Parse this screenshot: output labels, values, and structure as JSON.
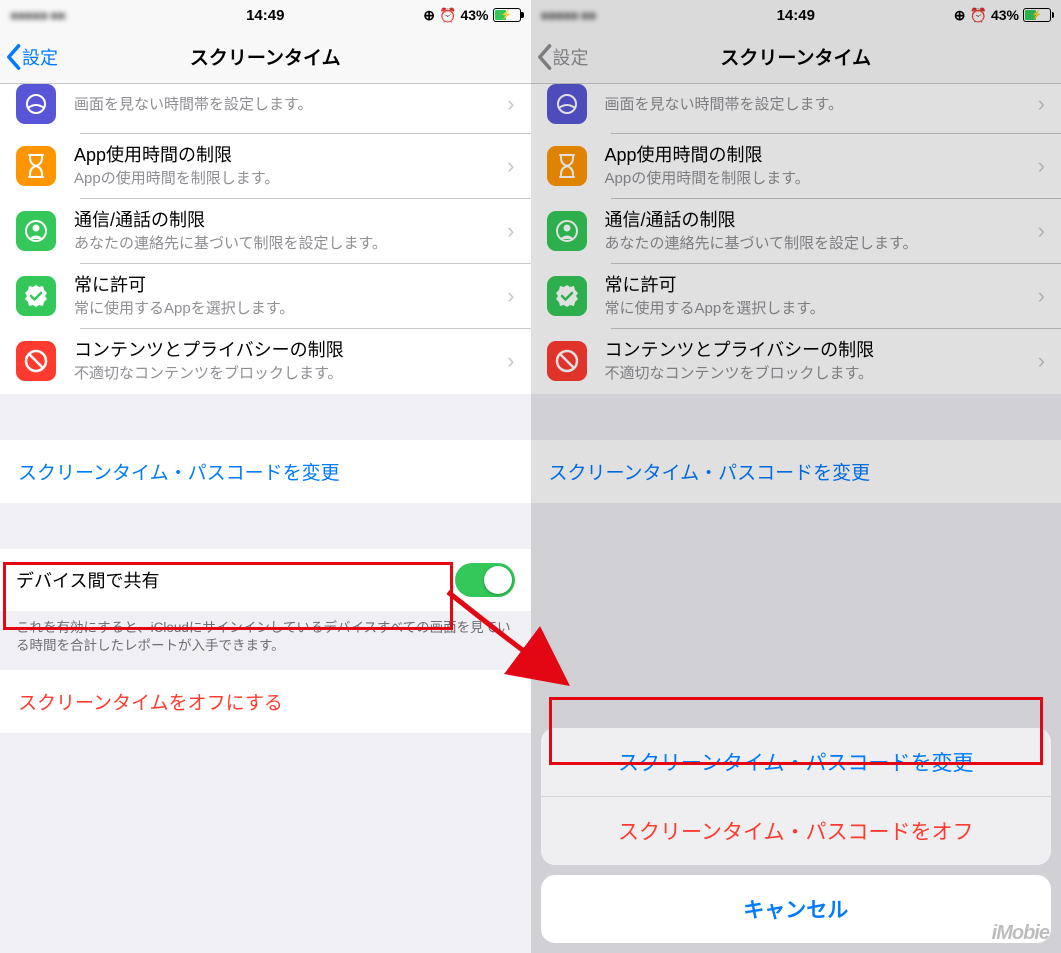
{
  "status": {
    "time": "14:49",
    "battery_pct": "43%",
    "lock_icon": "lock-rotation",
    "alarm_icon": "alarm"
  },
  "nav": {
    "back_label": "設定",
    "title": "スクリーンタイム"
  },
  "rows": {
    "downtime_sub": "画面を見ない時間帯を設定します。",
    "applimit_title": "App使用時間の制限",
    "applimit_sub": "Appの使用時間を制限します。",
    "comm_title": "通信/通話の制限",
    "comm_sub": "あなたの連絡先に基づいて制限を設定します。",
    "always_title": "常に許可",
    "always_sub": "常に使用するAppを選択します。",
    "content_title": "コンテンツとプライバシーの制限",
    "content_sub": "不適切なコンテンツをブロックします。"
  },
  "passcode_link": "スクリーンタイム・パスコードを変更",
  "share_title": "デバイス間で共有",
  "share_footer": "これを有効にすると、iCloudにサインインしているデバイスすべての画面を見ている時間を合計したレポートが入手できます。",
  "off_link": "スクリーンタイムをオフにする",
  "sheet": {
    "change": "スクリーンタイム・パスコードを変更",
    "off": "スクリーンタイム・パスコードをオフ",
    "cancel": "キャンセル"
  },
  "watermark": "iMobie"
}
